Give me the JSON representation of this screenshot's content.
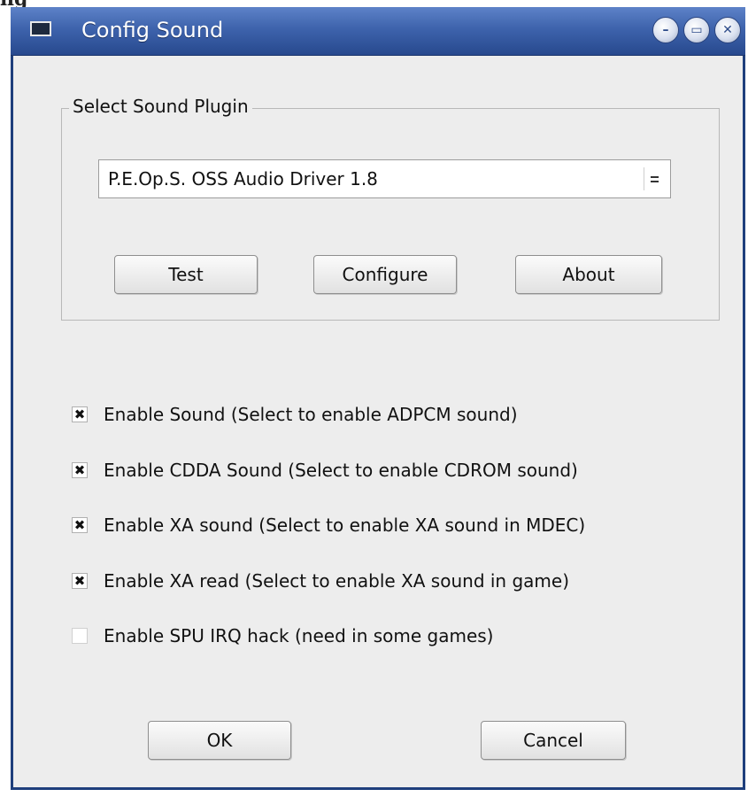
{
  "outside_title": "ng",
  "window": {
    "title": "Config Sound",
    "controls": [
      "minimize-icon",
      "maximize-icon",
      "close-icon"
    ]
  },
  "plugin_frame": {
    "legend": "Select Sound Plugin",
    "selected_plugin": "P.E.Op.S. OSS Audio Driver 1.8",
    "buttons": {
      "test": "Test",
      "configure": "Configure",
      "about": "About"
    }
  },
  "options": [
    {
      "label": "Enable Sound (Select to enable ADPCM sound)",
      "checked": true
    },
    {
      "label": "Enable CDDA Sound (Select to enable CDROM sound)",
      "checked": true
    },
    {
      "label": "Enable XA sound (Select to enable XA sound in MDEC)",
      "checked": true
    },
    {
      "label": "Enable XA read (Select to enable XA sound in game)",
      "checked": true
    },
    {
      "label": "Enable SPU IRQ hack (need in some games)",
      "checked": false
    }
  ],
  "check_mark": "✖",
  "footer": {
    "ok": "OK",
    "cancel": "Cancel"
  },
  "colors": {
    "titlebar": "#3e63ac",
    "border": "#1f3f7c",
    "dialog_bg": "#ededed"
  }
}
